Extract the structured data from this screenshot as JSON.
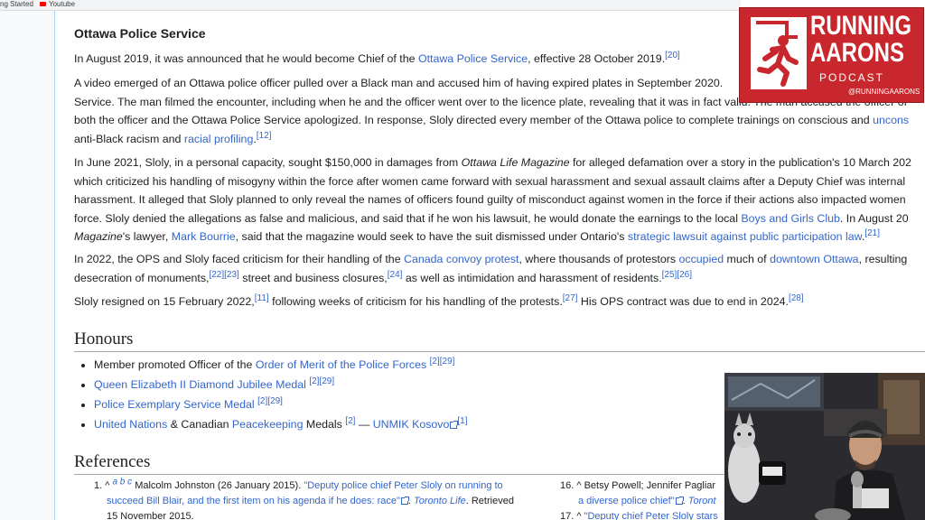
{
  "bookmarks": [
    {
      "label": "ng Started"
    },
    {
      "label": "Youtube"
    }
  ],
  "section_ops": {
    "title": "Ottawa Police Service",
    "p1": {
      "t1": "In August 2019, it was announced that he would become Chief of the ",
      "l1": "Ottawa Police Service",
      "t2": ", effective 28 October 2019.",
      "r1": "[20]"
    },
    "p2": {
      "line1": "A video emerged of an Ottawa police officer pulled over a Black man and accused him of having expired plates in September 2020.",
      "line2a": "Service. The man filmed the encounter, including when he and the officer went over to the licence plate, revealing that it was in fact valid. The man accused the officer of",
      "line3a": "both the officer and the Ottawa Police Service apologized. In response, Sloly directed every member of the Ottawa police to complete trainings on conscious and ",
      "line3l": "uncons",
      "line4a": "anti-Black racism and ",
      "line4l": "racial profiling",
      "line4t": ".",
      "line4r": "[12]"
    },
    "p3": {
      "line1a": "In June 2021, Sloly, in a personal capacity, sought $150,000 in damages from ",
      "line1i": "Ottawa Life Magazine",
      "line1b": " for alleged defamation over a story in the publication's 10 March 202",
      "line2": "which criticized his handling of misogyny within the force after women came forward with sexual harassment and sexual assault claims after a Deputy Chief was internal",
      "line3": "harassment. It alleged that Sloly planned to only reveal the names of officers found guilty of misconduct against women in the force if their actions also impacted women",
      "line4a": "force. Sloly denied the allegations as false and malicious, and said that if he won his lawsuit, he would donate the earnings to the local ",
      "line4l": "Boys and Girls Club",
      "line4b": ". In August 20",
      "line5i": "Magazine",
      "line5a": "'s lawyer, ",
      "line5l1": "Mark Bourrie",
      "line5b": ", said that the magazine would seek to have the suit dismissed under Ontario's ",
      "line5l2": "strategic lawsuit against public participation law",
      "line5c": ".",
      "line5r": "[21]"
    },
    "p4": {
      "line1a": "In 2022, the OPS and Sloly faced criticism for their handling of the ",
      "line1l1": "Canada convoy protest",
      "line1b": ", where thousands of protestors ",
      "line1l2": "occupied",
      "line1c": " much of ",
      "line1l3": "downtown Ottawa",
      "line1d": ", resulting",
      "line2a": "desecration of monuments,",
      "line2r1": "[22][23]",
      "line2b": " street and business closures,",
      "line2r2": "[24]",
      "line2c": " as well as intimidation and harassment of residents.",
      "line2r3": "[25][26]"
    },
    "p5": {
      "t1": "Sloly resigned on 15 February 2022,",
      "r1": "[11]",
      "t2": " following weeks of criticism for his handling of the protests.",
      "r2": "[27]",
      "t3": " His OPS contract was due to end in 2024.",
      "r3": "[28]"
    }
  },
  "honours": {
    "title": "Honours",
    "items": [
      {
        "pre": "Member promoted Officer of the ",
        "link": "Order of Merit of the Police Forces",
        "refs": "[2][29]"
      },
      {
        "link": "Queen Elizabeth II Diamond Jubilee Medal",
        "refs": "[2][29]"
      },
      {
        "link": "Police Exemplary Service Medal",
        "refs": "[2][29]"
      },
      {
        "link": "United Nations",
        "mid": " & Canadian ",
        "link2": "Peacekeeping",
        "mid2": " Medals ",
        "refs": "[2]",
        "dash": " — ",
        "link3": "UNMIK Kosovo",
        "refs2": "[1]"
      }
    ]
  },
  "references": {
    "title": "References",
    "r1": {
      "num": "1.",
      "caret": "^ ",
      "letters": "a b c",
      "author": " Malcolm Johnston (26 January 2015). ",
      "title1": "\"Deputy police chief Peter Sloly on running to",
      "title2": "succeed Bill Blair, and the first item on his agenda if he does: race\"",
      "pub": "Toronto Life",
      "ret": ". Retrieved",
      "date": "15 November 2015."
    },
    "r16": {
      "num": "16.",
      "caret": "^ ",
      "author": "Betsy Powell; Jennifer Pagliar",
      "title2": "a diverse police chief\"",
      "pub": " Toront"
    },
    "r17": {
      "num": "17.",
      "caret": "^ ",
      "title": "\"Deputy chief Peter Sloly stars"
    }
  },
  "logo": {
    "line1": "RUNNING",
    "line2": "AARONS",
    "line3": "PODCAST",
    "handle": "@RUNNINGAARONS",
    "tile_icon": "running-man-icon",
    "bg_color": "#c8282d"
  },
  "webcam": {
    "label": "webcam-feed"
  }
}
